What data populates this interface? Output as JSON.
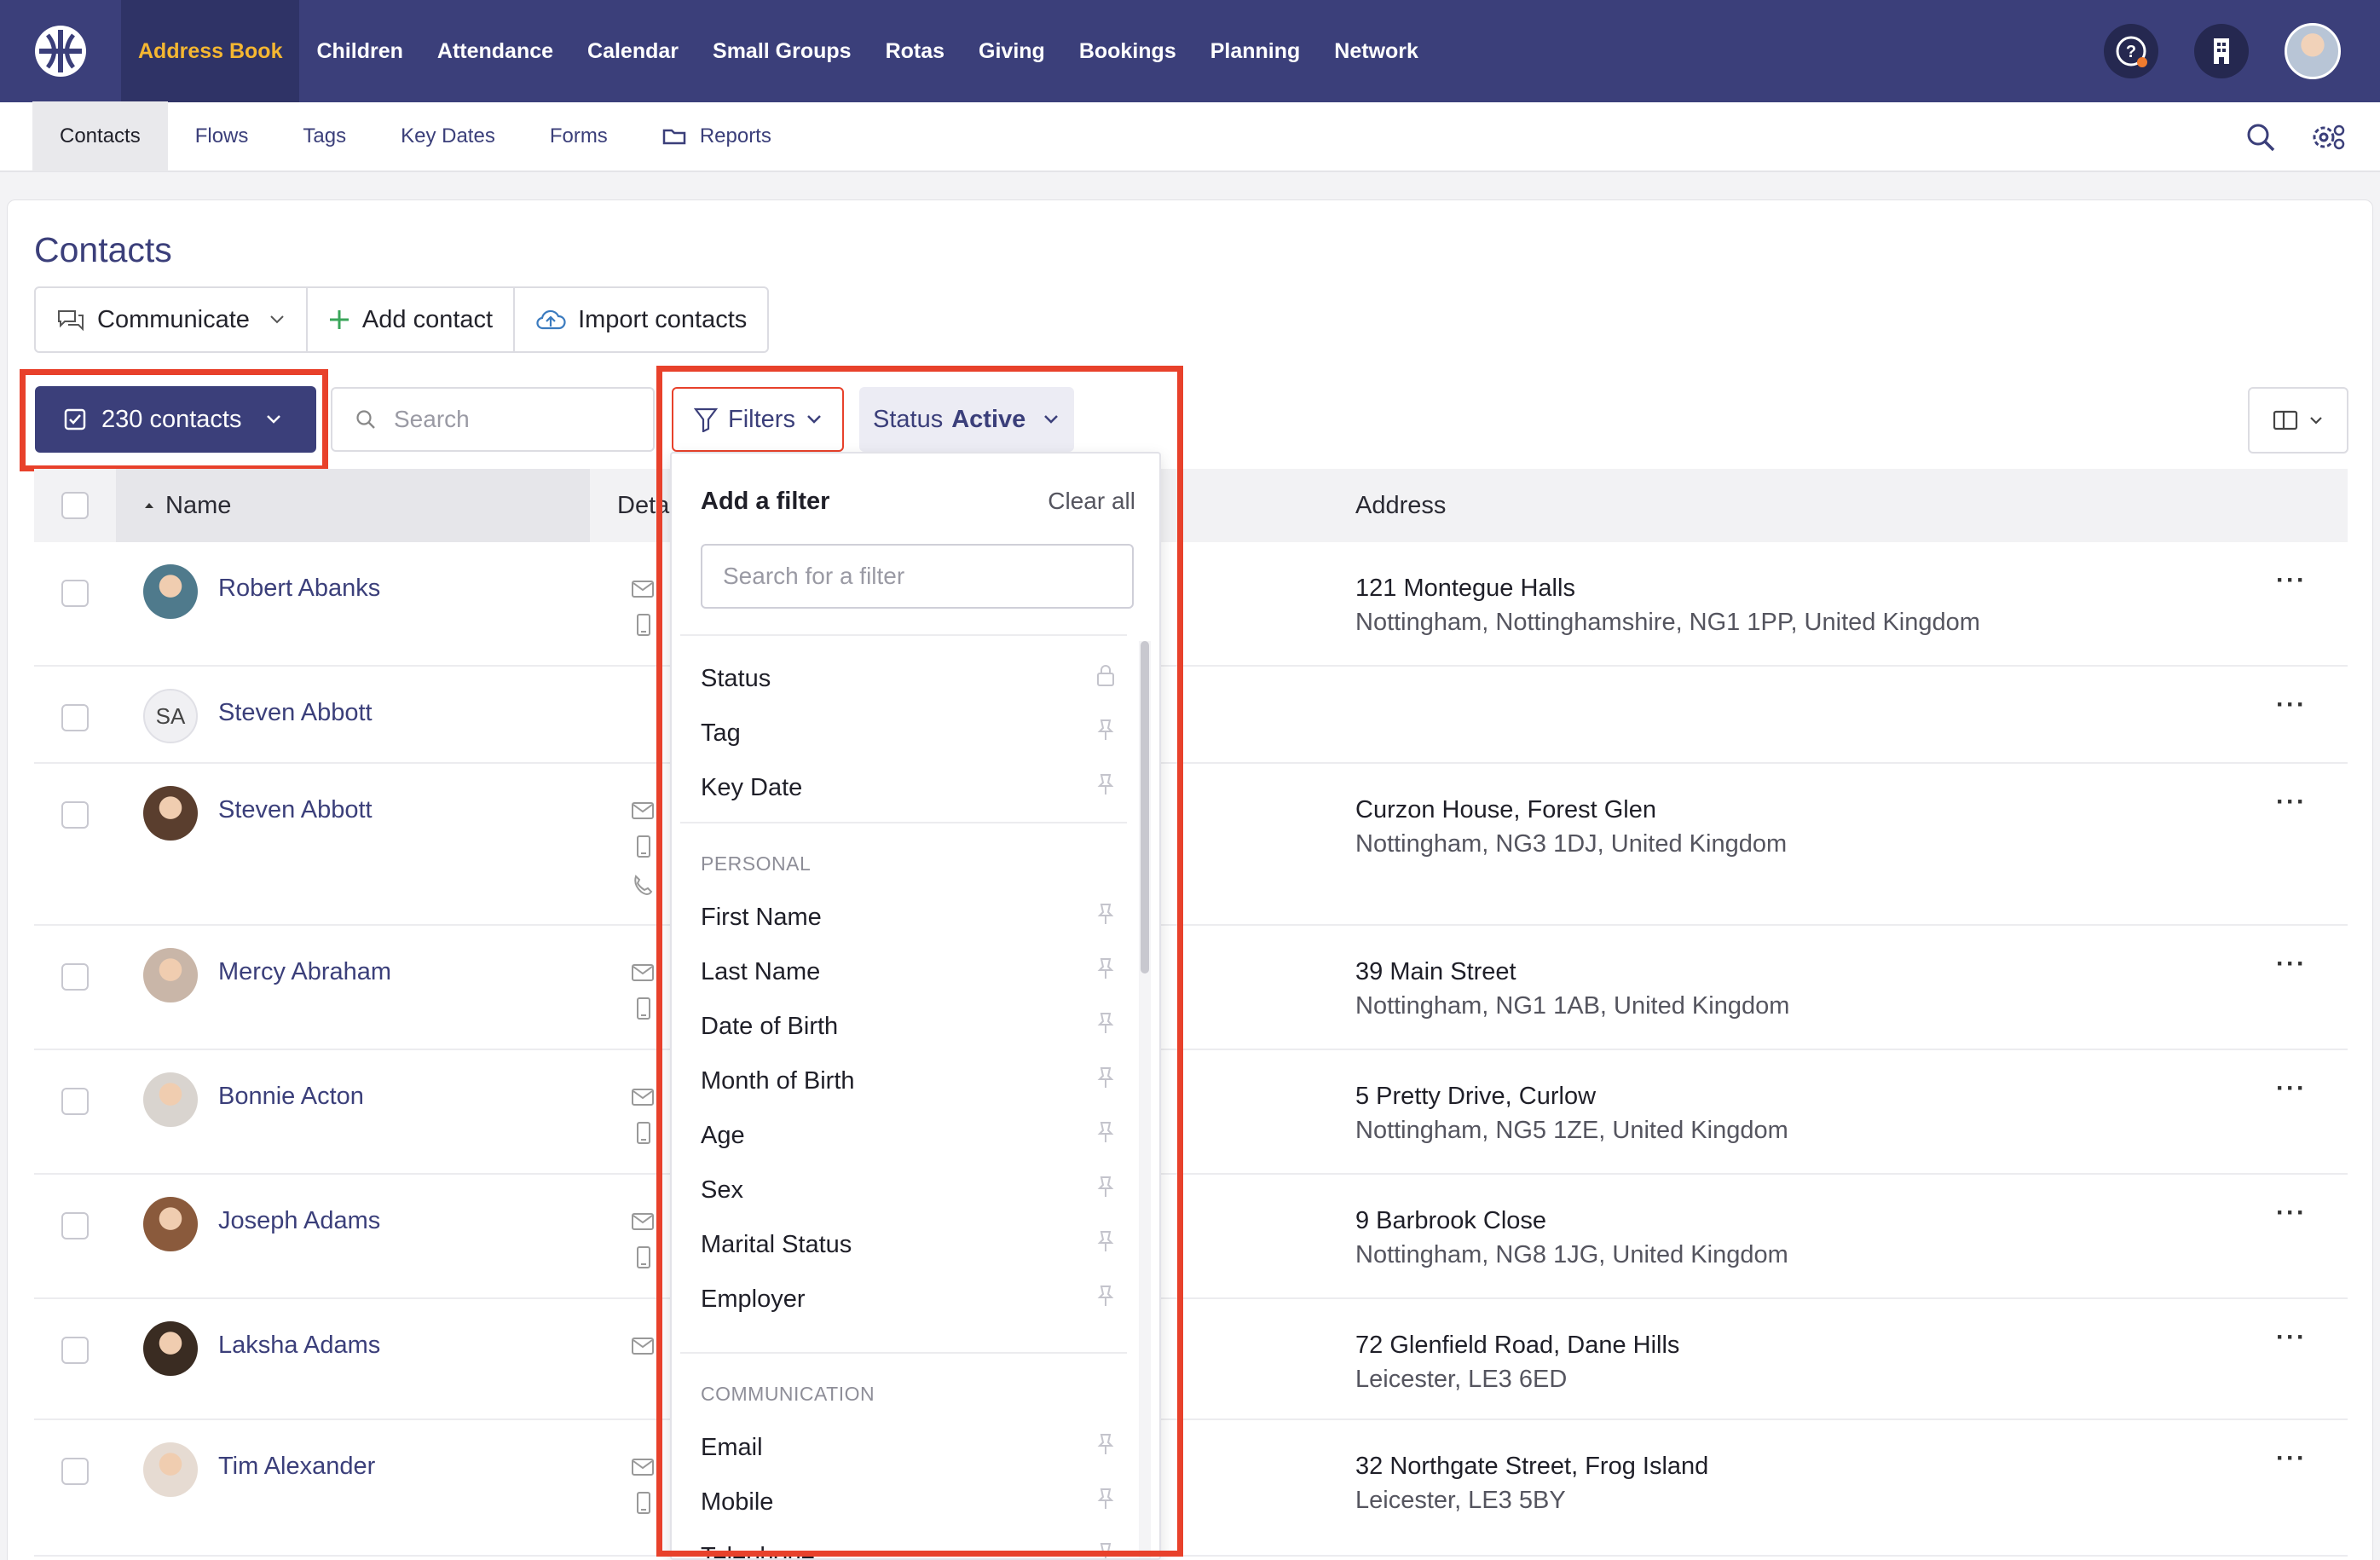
{
  "top_nav": {
    "logo_icon": "globe-logo-icon",
    "items": [
      {
        "label": "Address Book",
        "active": true
      },
      {
        "label": "Children"
      },
      {
        "label": "Attendance"
      },
      {
        "label": "Calendar"
      },
      {
        "label": "Small Groups"
      },
      {
        "label": "Rotas"
      },
      {
        "label": "Giving"
      },
      {
        "label": "Bookings"
      },
      {
        "label": "Planning"
      },
      {
        "label": "Network"
      }
    ],
    "right_icons": [
      "help-icon",
      "building-icon",
      "avatar"
    ]
  },
  "sub_nav": {
    "items": [
      {
        "label": "Contacts",
        "active": true
      },
      {
        "label": "Flows"
      },
      {
        "label": "Tags"
      },
      {
        "label": "Key Dates"
      },
      {
        "label": "Forms"
      },
      {
        "label": "Reports",
        "icon": "folder-icon"
      }
    ],
    "right_icons": [
      "search-icon",
      "settings-icon"
    ]
  },
  "page": {
    "title": "Contacts",
    "actions": {
      "communicate": "Communicate",
      "add_contact": "Add contact",
      "import_contacts": "Import contacts"
    },
    "contacts_count_label": "230 contacts",
    "search_placeholder": "Search",
    "filters_label": "Filters",
    "status_chip": {
      "key": "Status",
      "value": "Active"
    }
  },
  "table": {
    "columns": {
      "name": "Name",
      "details": "Deta",
      "address": "Address"
    },
    "rows": [
      {
        "name": "Robert Abanks",
        "initials": "",
        "avatar_color": "#4f7a8c",
        "details": [
          "mail",
          "mobile"
        ],
        "addr1": "121 Montegue Halls",
        "addr2": "Nottingham, Nottinghamshire, NG1 1PP, United Kingdom"
      },
      {
        "name": "Steven Abbott",
        "initials": "SA",
        "avatar_color": "",
        "details": [],
        "addr1": "",
        "addr2": ""
      },
      {
        "name": "Steven Abbott",
        "initials": "",
        "avatar_color": "#5a3e2e",
        "details": [
          "mail",
          "mobile",
          "phone"
        ],
        "addr1": "Curzon House, Forest Glen",
        "addr2": "Nottingham, NG3 1DJ, United Kingdom"
      },
      {
        "name": "Mercy Abraham",
        "initials": "",
        "avatar_color": "#c9b6a8",
        "details": [
          "mail",
          "mobile"
        ],
        "addr1": "39 Main Street",
        "addr2": "Nottingham, NG1 1AB, United Kingdom"
      },
      {
        "name": "Bonnie Acton",
        "initials": "",
        "avatar_color": "#d9d4cf",
        "details": [
          "mail",
          "mobile"
        ],
        "addr1": "5 Pretty Drive, Curlow",
        "addr2": "Nottingham, NG5 1ZE, United Kingdom"
      },
      {
        "name": "Joseph Adams",
        "initials": "",
        "avatar_color": "#8a5a3c",
        "details": [
          "mail",
          "mobile"
        ],
        "addr1": "9 Barbrook Close",
        "addr2": "Nottingham, NG8 1JG, United Kingdom"
      },
      {
        "name": "Laksha Adams",
        "initials": "",
        "avatar_color": "#3a2c22",
        "details": [
          "mail"
        ],
        "addr1": "72 Glenfield Road, Dane Hills",
        "addr2": "Leicester, LE3 6ED"
      },
      {
        "name": "Tim Alexander",
        "initials": "",
        "avatar_color": "#e6dbd2",
        "details": [
          "mail",
          "mobile"
        ],
        "addr1": "32 Northgate Street, Frog Island",
        "addr2": "Leicester, LE3 5BY"
      }
    ]
  },
  "filter_dropdown": {
    "title": "Add a filter",
    "clear_all": "Clear all",
    "search_placeholder": "Search for a filter",
    "top_items": [
      {
        "label": "Status",
        "icon": "lock-icon"
      },
      {
        "label": "Tag",
        "icon": "pin-icon"
      },
      {
        "label": "Key Date",
        "icon": "pin-icon"
      }
    ],
    "sections": [
      {
        "title": "PERSONAL",
        "items": [
          "First Name",
          "Last Name",
          "Date of Birth",
          "Month of Birth",
          "Age",
          "Sex",
          "Marital Status",
          "Employer"
        ]
      },
      {
        "title": "COMMUNICATION",
        "items": [
          "Email",
          "Mobile",
          "Telephone"
        ]
      }
    ]
  },
  "colors": {
    "nav_bg": "#3b3f7a",
    "nav_active_text": "#f5b731",
    "highlight": "#e8412b",
    "link": "#3b3f7a"
  }
}
